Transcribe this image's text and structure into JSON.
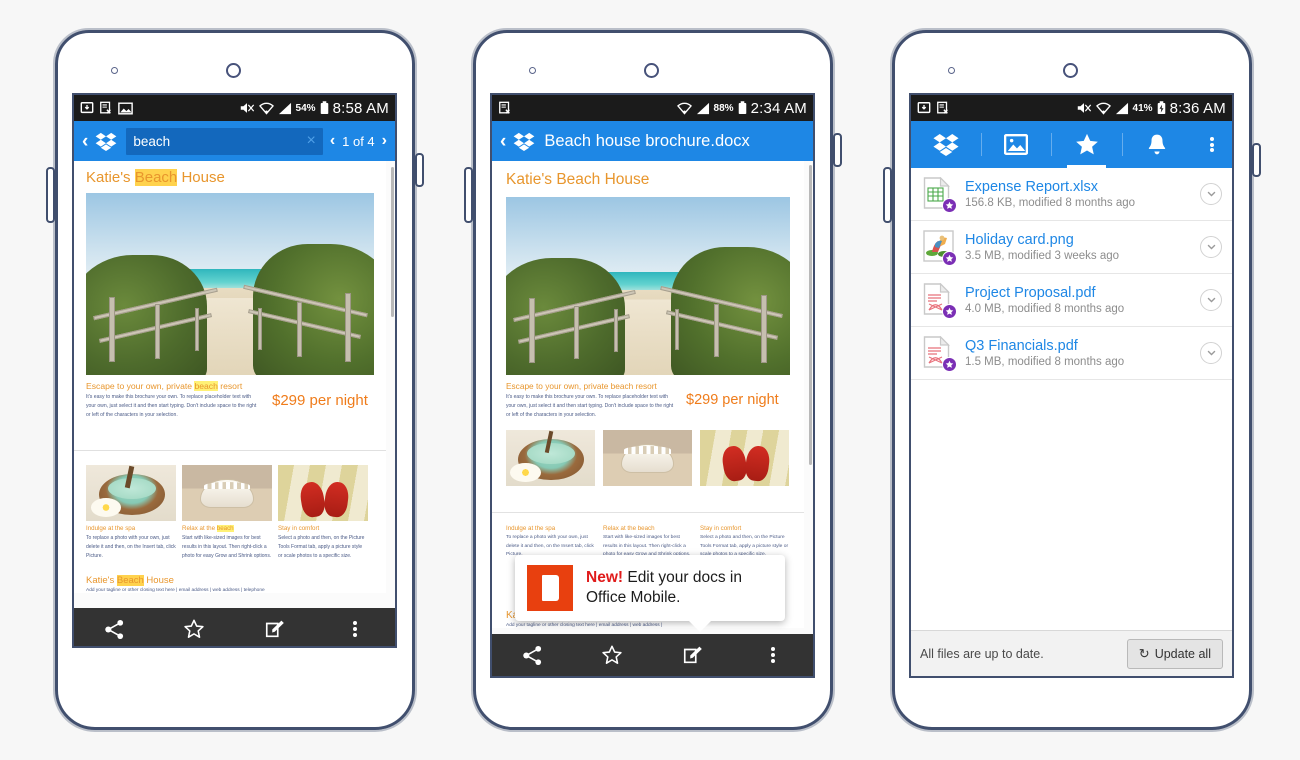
{
  "phones": [
    {
      "id": "phone-search",
      "status": {
        "time": "8:58 AM",
        "battery_pct": "54%",
        "icons": [
          "download-icon",
          "doc-x-icon",
          "image-icon",
          "mute-icon",
          "wifi-icon",
          "signal-icon",
          "battery-icon"
        ]
      },
      "appbar": {
        "back_label": "‹",
        "search_value": "beach",
        "search_placeholder": "Search",
        "clear_label": "×",
        "prev_label": "‹",
        "match_count": "1 of 4",
        "next_label": "›"
      },
      "document": {
        "title_plain_1": "Katie's ",
        "title_highlight": "Beach",
        "title_plain_2": " House",
        "hero_caption_pre": "Escape to your own, private ",
        "hero_caption_hl": "beach",
        "hero_caption_post": " resort",
        "hero_body": "It's easy to make this brochure your own. To replace placeholder text with your own, just select it and then start typing. Don't include space to the right or left of the characters in your selection.",
        "price": "$299 per night",
        "cards": [
          {
            "heading": "Indulge at the spa",
            "heading_hl": "",
            "body": "To replace a photo with your own, just delete it and then, on the Insert tab, click Picture."
          },
          {
            "heading": "Relax at the ",
            "heading_hl": "beach",
            "body": "Start with like-sized images for best results in this layout. Then right-click a photo for easy Grow and Shrink options."
          },
          {
            "heading": "Stay in comfort",
            "heading_hl": "",
            "body": "Select a photo and then, on the Picture Tools Format tab, apply a picture style or scale photos to a specific size."
          }
        ],
        "footer_plain_1": "Katie's ",
        "footer_highlight": "Beach",
        "footer_plain_2": " House",
        "footer_tagline": "Add your tagline or other closing text here  |  email address  |  web address  |  telephone"
      },
      "toolbar": [
        {
          "name": "share-button",
          "icon": "share-icon"
        },
        {
          "name": "favorite-button",
          "icon": "star-icon"
        },
        {
          "name": "edit-button",
          "icon": "edit-icon"
        },
        {
          "name": "overflow-button",
          "icon": "kebab-icon"
        }
      ]
    },
    {
      "id": "phone-preview",
      "status": {
        "time": "2:34 AM",
        "battery_pct": "88%",
        "icons": [
          "doc-x-icon",
          "wifi-icon",
          "signal-icon",
          "battery-icon"
        ]
      },
      "appbar": {
        "back_label": "‹",
        "title": "Beach house brochure.docx"
      },
      "document": {
        "title": "Katie's Beach House",
        "hero_caption": "Escape to your own, private beach resort",
        "hero_body": "It's easy to make this brochure your own. To replace placeholder text with your own, just select it and then start typing. Don't include space to the right or left of the characters in your selection.",
        "price": "$299 per night",
        "cards": [
          {
            "heading": "Indulge at the spa",
            "body": "To replace a photo with your own, just delete it and then, on the Insert tab, click Picture."
          },
          {
            "heading": "Relax at the beach",
            "body": "Start with like-sized images for best results in this layout. Then right-click a photo for easy Grow and Shrink options."
          },
          {
            "heading": "Stay in comfort",
            "body": "Select a photo and then, on the Picture Tools Format tab, apply a picture style or scale photos to a specific size."
          }
        ],
        "footer_title": "Katie's Beach House",
        "footer_tagline": "Add your tagline or other closing text here  |  email address  |  web address  |"
      },
      "popup": {
        "badge": "New!",
        "message": " Edit your docs in Office Mobile.",
        "icon": "office-icon"
      },
      "toolbar": [
        {
          "name": "share-button",
          "icon": "share-icon"
        },
        {
          "name": "favorite-button",
          "icon": "star-icon"
        },
        {
          "name": "edit-button",
          "icon": "edit-icon"
        },
        {
          "name": "overflow-button",
          "icon": "kebab-icon"
        }
      ]
    },
    {
      "id": "phone-favorites",
      "status": {
        "time": "8:36 AM",
        "battery_pct": "41%",
        "icons": [
          "download-icon",
          "doc-x-icon",
          "mute-icon",
          "wifi-icon",
          "signal-icon",
          "battery-charging-icon"
        ]
      },
      "tabs": [
        {
          "name": "tab-dropbox",
          "icon": "dropbox-icon",
          "selected": false
        },
        {
          "name": "tab-photos",
          "icon": "photos-icon",
          "selected": false
        },
        {
          "name": "tab-favorites",
          "icon": "star-icon",
          "selected": true
        },
        {
          "name": "tab-notifications",
          "icon": "bell-icon",
          "selected": false
        }
      ],
      "overflow": {
        "name": "overflow-button",
        "icon": "kebab-icon"
      },
      "files": [
        {
          "name": "Expense Report.xlsx",
          "meta": "156.8 KB, modified 8 months ago",
          "icon": "xlsx-file-icon",
          "starred": true
        },
        {
          "name": "Holiday card.png",
          "meta": "3.5 MB, modified 3 weeks ago",
          "icon": "png-thumbnail-icon",
          "starred": true
        },
        {
          "name": "Project Proposal.pdf",
          "meta": "4.0 MB, modified 8 months ago",
          "icon": "pdf-file-icon",
          "starred": true
        },
        {
          "name": "Q3 Financials.pdf",
          "meta": "1.5 MB, modified 8 months ago",
          "icon": "pdf-file-icon",
          "starred": true
        }
      ],
      "sync": {
        "status_text": "All files are up to date.",
        "button_label": "Update all",
        "button_icon": "refresh-icon"
      }
    }
  ],
  "colors": {
    "dropbox_blue": "#1e87e5",
    "search_field": "#1368bd",
    "status_bar": "#1b1b1b",
    "doc_toolbar": "#333333",
    "accent_orange": "#e8962d",
    "price_orange": "#ef7c1b",
    "highlight_yellow": "#ffd24d",
    "star_purple": "#7b2fb5",
    "office_red": "#e8400f",
    "frame_navy": "#414f6e"
  }
}
